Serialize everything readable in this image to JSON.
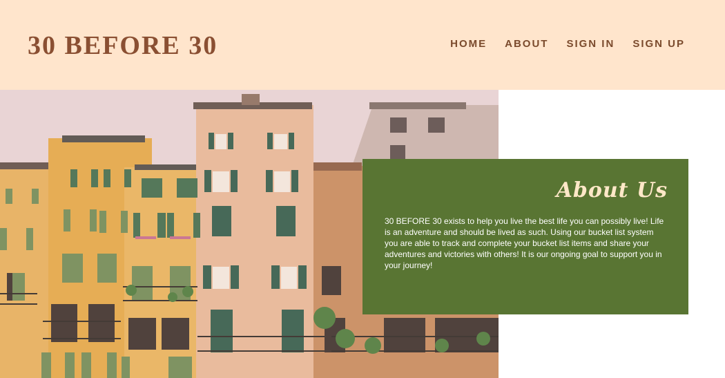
{
  "site": {
    "logo": "30 BEFORE 30"
  },
  "nav": {
    "items": [
      "HOME",
      "ABOUT",
      "SIGN IN",
      "SIGN UP"
    ]
  },
  "about": {
    "title": "About Us",
    "text": "30 BEFORE 30 exists to help you live the best life you can possibly live! Life is an adventure and should be lived as such. Using our bucket list system you are able to track and complete your bucket list items and share your adventures and victories with others! It is our ongoing goal to support you in your journey!"
  },
  "colors": {
    "header_bg": "#ffe5cc",
    "brand_brown": "#8a4f32",
    "card_green": "#597533",
    "title_cream": "#ffe8c8"
  }
}
